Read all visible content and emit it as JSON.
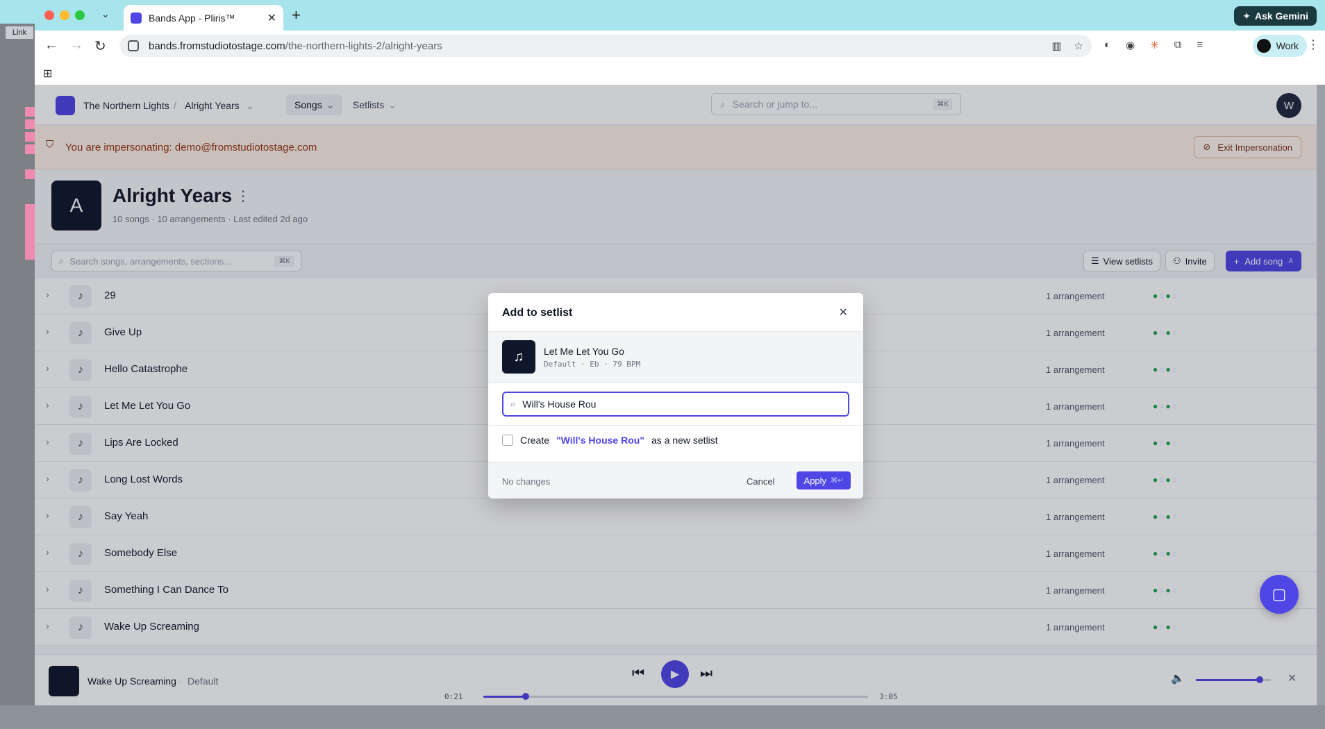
{
  "browser": {
    "tab_title": "Bands App - Pliris™",
    "url_host": "bands.fromstudiotostage.com",
    "url_path": "/the-northern-lights-2/alright-years",
    "ask_gemini": "Ask Gemini",
    "profile": "Work"
  },
  "daw": {
    "link_label": "Link"
  },
  "header": {
    "band": "The Northern Lights",
    "project": "Alright Years",
    "nav_songs": "Songs",
    "nav_setlists": "Setlists",
    "search_placeholder": "Search or jump to...",
    "search_kbd": "⌘K",
    "avatar_initial": "W"
  },
  "banner": {
    "text": "You are impersonating: demo@fromstudiotostage.com",
    "exit_label": "Exit Impersonation"
  },
  "project": {
    "initial": "A",
    "title": "Alright Years",
    "meta": "10 songs · 10 arrangements · Last edited 2d ago"
  },
  "list_toolbar": {
    "search_placeholder": "Search songs, arrangements, sections...",
    "search_kbd": "⌘K",
    "view_setlists": "View setlists",
    "invite": "Invite",
    "add_song": "Add song",
    "add_song_kbd": "A"
  },
  "songs": [
    {
      "title": "29",
      "arrangements": "1 arrangement"
    },
    {
      "title": "Give Up",
      "arrangements": "1 arrangement"
    },
    {
      "title": "Hello Catastrophe",
      "arrangements": "1 arrangement"
    },
    {
      "title": "Let Me Let You Go",
      "arrangements": "1 arrangement"
    },
    {
      "title": "Lips Are Locked",
      "arrangements": "1 arrangement"
    },
    {
      "title": "Long Lost Words",
      "arrangements": "1 arrangement"
    },
    {
      "title": "Say Yeah",
      "arrangements": "1 arrangement"
    },
    {
      "title": "Somebody Else",
      "arrangements": "1 arrangement"
    },
    {
      "title": "Something I Can Dance To",
      "arrangements": "1 arrangement"
    },
    {
      "title": "Wake Up Screaming",
      "arrangements": "1 arrangement"
    }
  ],
  "player": {
    "title": "Wake Up Screaming",
    "arrangement": "Default",
    "elapsed": "0:21",
    "duration": "3:05",
    "progress": 0.11,
    "volume": 0.85
  },
  "modal": {
    "title": "Add to setlist",
    "song_title": "Let Me Let You Go",
    "song_meta": "Default · Eb · 79 BPM",
    "search_value": "Will's House Rou",
    "create_prefix": "Create",
    "create_name": "\"Will's House Rou\"",
    "create_suffix": "as a new setlist",
    "status": "No changes",
    "cancel": "Cancel",
    "apply": "Apply",
    "apply_kbd": "⌘↵"
  },
  "colors": {
    "accent": "#4f46e5",
    "banner": "#fdf0e6",
    "status_green": "#16a34a"
  }
}
